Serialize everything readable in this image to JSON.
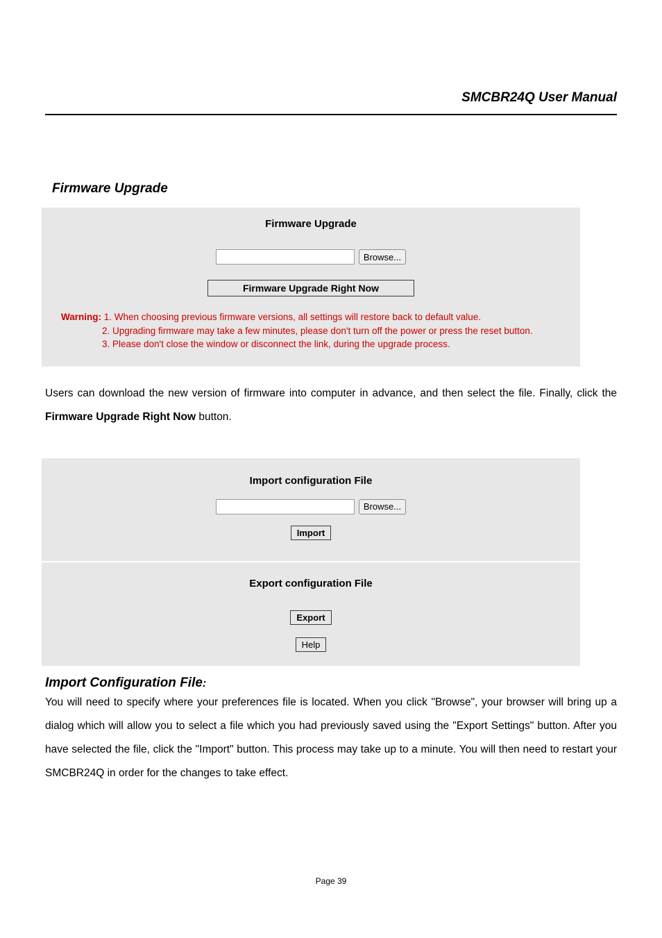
{
  "header": {
    "title": "SMCBR24Q User Manual"
  },
  "section1": {
    "heading": "Firmware Upgrade",
    "panel_title": "Firmware Upgrade",
    "browse_label": "Browse...",
    "upgrade_button": "Firmware Upgrade Right Now",
    "warning_label": "Warning:",
    "warning_1": "1. When choosing previous firmware versions, all settings will restore back to default value.",
    "warning_2": "2. Upgrading firmware may take a few minutes, please don't turn off the power or press the reset button.",
    "warning_3": "3. Please don't close the window or disconnect the link, during the upgrade process."
  },
  "body1": {
    "pre": "Users can download the new version of firmware into computer in advance, and then select the file. Finally, click the ",
    "bold": "Firmware Upgrade Right Now",
    "post": " button."
  },
  "import_panel": {
    "title": "Import configuration File",
    "browse_label": "Browse...",
    "import_button": "Import"
  },
  "export_panel": {
    "title": "Export configuration File",
    "export_button": "Export",
    "help_button": "Help"
  },
  "section2": {
    "heading": "Import Configuration File",
    "colon": ":",
    "body": "You will need to specify where your preferences file is located. When you click \"Browse\", your browser will bring up a dialog which will allow you to select a file which you had previously saved using the \"Export Settings\" button. After you have selected the file, click the \"Import\" button. This process may take up to a minute.   You will then need to restart your SMCBR24Q in order for the changes to take effect."
  },
  "footer": {
    "page": "Page 39"
  }
}
